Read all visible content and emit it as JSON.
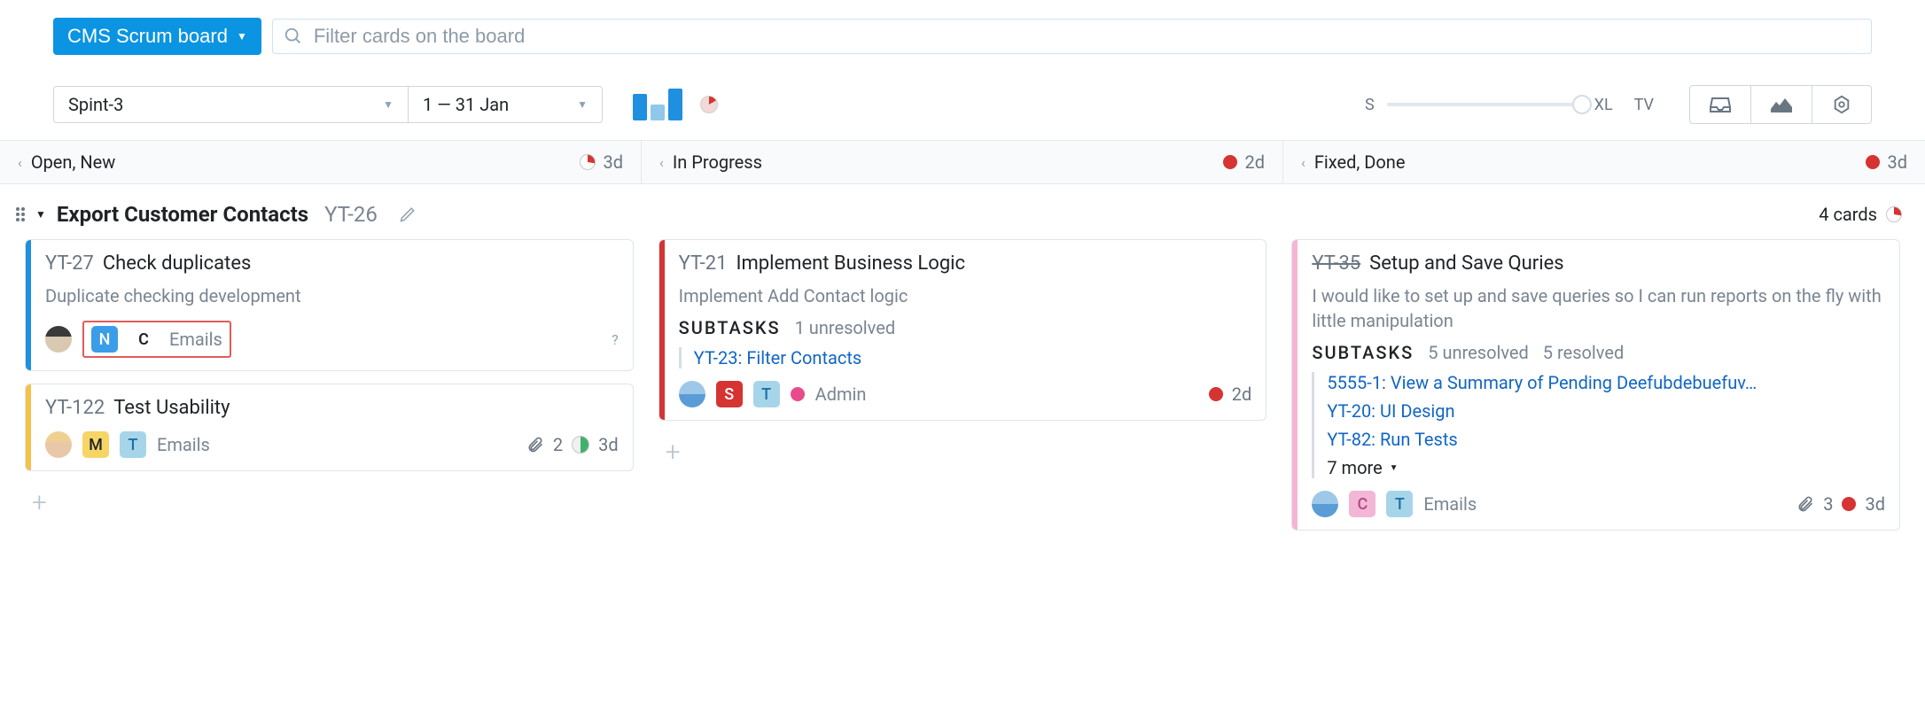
{
  "header": {
    "board_name": "CMS Scrum board",
    "search_placeholder": "Filter cards on the board"
  },
  "controls": {
    "sprint": "Spint-3",
    "date_range": "1 — 31 Jan",
    "slider_min": "S",
    "slider_max": "XL",
    "tv_label": "TV"
  },
  "columns": [
    {
      "title": "Open, New",
      "time": "3d",
      "indicator": "pie"
    },
    {
      "title": "In Progress",
      "time": "2d",
      "indicator": "dot"
    },
    {
      "title": "Fixed, Done",
      "time": "3d",
      "indicator": "dot"
    }
  ],
  "swimlane": {
    "title": "Export Customer Contacts",
    "id": "YT-26",
    "count_label": "4 cards"
  },
  "cards": {
    "yt27": {
      "id": "YT-27",
      "title": "Check duplicates",
      "desc": "Duplicate checking development",
      "badge_n": "N",
      "badge_c": "C",
      "tag": "Emails",
      "q": "?"
    },
    "yt122": {
      "id": "YT-122",
      "title": "Test Usability",
      "badge_m": "M",
      "badge_t": "T",
      "tag": "Emails",
      "attach": "2",
      "time": "3d"
    },
    "yt21": {
      "id": "YT-21",
      "title": "Implement Business Logic",
      "desc": "Implement Add Contact logic",
      "sub_label": "SUBTASKS",
      "sub_info": "1 unresolved",
      "subtask1": "YT-23: Filter Contacts",
      "badge_s": "S",
      "badge_t": "T",
      "role": "Admin",
      "time": "2d"
    },
    "yt35": {
      "id": "YT-35",
      "title": "Setup and Save Quries",
      "desc": "I would like to set up and save queries so I can run reports on the fly with little manipulation",
      "sub_label": "SUBTASKS",
      "sub_unresolved": "5 unresolved",
      "sub_resolved": "5 resolved",
      "st1": "5555-1: View a Summary of Pending Deefubdebuefuv…",
      "st2": "YT-20: UI Design",
      "st3": "YT-82: Run Tests",
      "more": "7 more",
      "badge_c": "C",
      "badge_t": "T",
      "tag": "Emails",
      "attach": "3",
      "time": "3d"
    }
  }
}
